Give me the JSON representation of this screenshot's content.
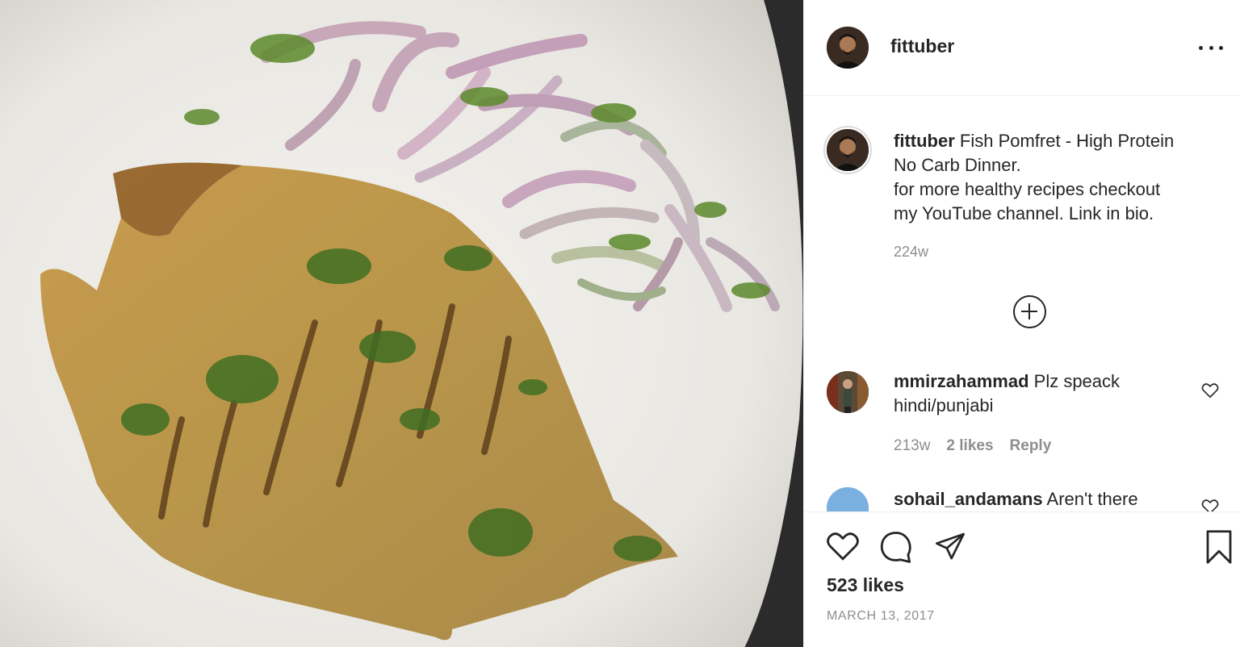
{
  "post": {
    "image_alt": "",
    "author": {
      "username": "fittuber"
    },
    "caption": {
      "username": "fittuber",
      "lines": [
        "Fish Pomfret - High Protein",
        "No Carb Dinner.",
        "for more healthy recipes checkout",
        "my YouTube channel. Link in bio."
      ],
      "time": "224w"
    },
    "comments": [
      {
        "username": "mmirzahammad",
        "text": "Plz speack hindi/punjabi",
        "time": "213w",
        "likes": "2 likes",
        "reply": "Reply"
      },
      {
        "username": "sohail_andamans",
        "text": "Aren't there"
      }
    ],
    "likes": "523 likes",
    "date": "MARCH 13, 2017"
  },
  "icons": {
    "more": "more-options-icon",
    "load_more": "plus-circle-icon",
    "like": "heart-icon",
    "comment": "comment-icon",
    "share": "share-icon",
    "save": "bookmark-icon",
    "comment_like": "heart-icon"
  },
  "colors": {
    "text": "#262626",
    "secondary": "#8e8e8e",
    "border": "#efefef"
  }
}
